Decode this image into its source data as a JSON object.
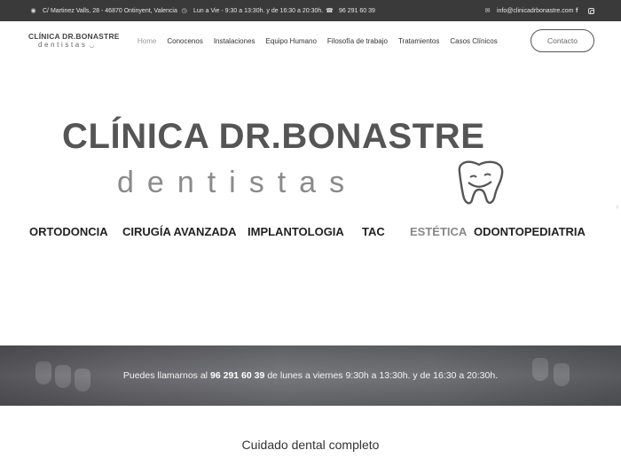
{
  "topbar": {
    "address": "C/ Martinez Valls, 28 - 46870 Ontinyent, Valencia",
    "hours": "Lun a Vie - 9:30 a 13:30h. y de 16:30 a 20:30h.",
    "phone": "96 291 60 39",
    "email": "info@clinicadrbonastre.com",
    "icons": {
      "address": "location-pin-icon",
      "hours": "clock-icon",
      "phone": "phone-icon",
      "email": "envelope-icon",
      "facebook": "facebook-icon",
      "instagram": "instagram-icon"
    }
  },
  "logo": {
    "line1": "CLÍNICA DR.BONASTRE",
    "line2": "dentistas"
  },
  "nav": {
    "items": [
      "Home",
      "Conocenos",
      "Instalaciones",
      "Equipo Humano",
      "Filosofía de trabajo",
      "Tratamientos",
      "Casos Clínicos"
    ],
    "active": "Home",
    "contact_label": "Contacto"
  },
  "hero": {
    "title": "CLÍNICA DR.BONASTRE",
    "subtitle": "dentistas",
    "services": [
      "ORTODONCIA",
      "CIRUGÍA AVANZADA",
      "IMPLANTOLOGIA",
      "TAC",
      "ESTÉTICA",
      "ODONTOPEDIATRIA"
    ]
  },
  "banner": {
    "prefix": "Puedes llamarnos al",
    "phone": "96 291 60 39",
    "suffix": "de lunes a viernes 9:30h a 13:30h. y de 16:30 a 20:30h."
  },
  "section": {
    "title": "Cuidado dental completo"
  },
  "colors": {
    "topbar_bg": "#3a3a3a",
    "text_dark": "#222222",
    "text_muted": "#888888",
    "banner_bg": "#6e6e72"
  }
}
